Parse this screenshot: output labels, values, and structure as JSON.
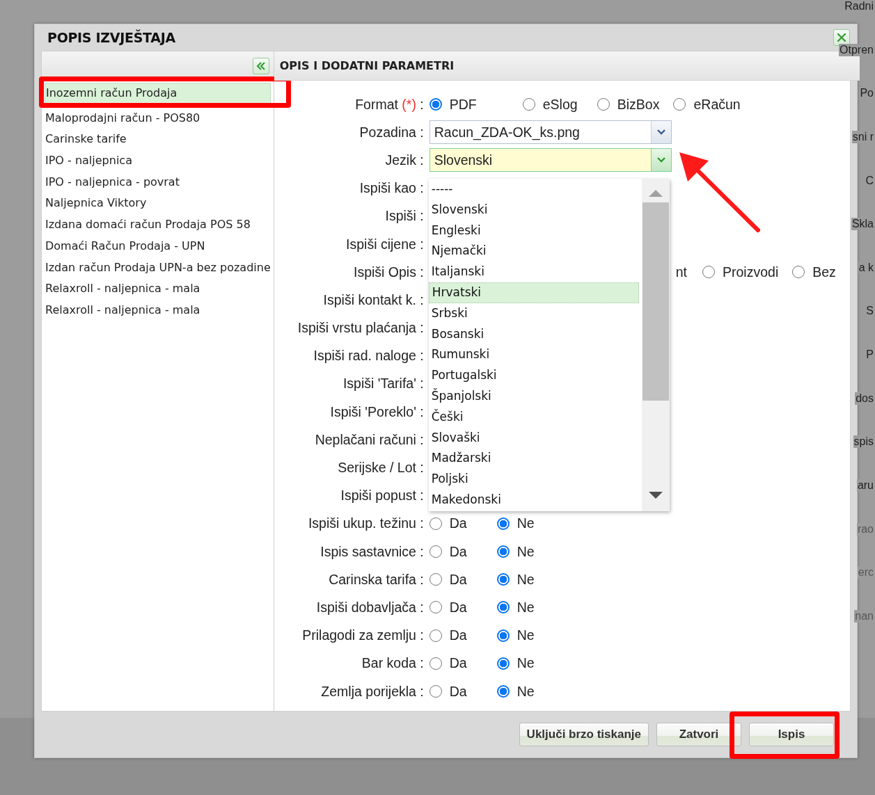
{
  "background_page": {
    "fragments": [
      "Radni",
      "Otpren",
      "Po",
      "sni r",
      "C",
      "Skla",
      "a k",
      "S",
      "P",
      "dos",
      "spis",
      "aru",
      "rao",
      "erc",
      "nan"
    ]
  },
  "dialog": {
    "title": "POPIS IZVJEŠTAJA"
  },
  "report_list": {
    "items": [
      {
        "label": "Inozemni račun Prodaja",
        "selected": true,
        "annotated": true
      },
      {
        "label": "Maloprodajni račun - POS80",
        "selected": false,
        "annotated": false
      },
      {
        "label": "Carinske tarife",
        "selected": false,
        "annotated": false
      },
      {
        "label": "IPO - naljepnica",
        "selected": false,
        "annotated": false
      },
      {
        "label": "IPO - naljepnica - povrat",
        "selected": false,
        "annotated": false
      },
      {
        "label": "Naljepnica Viktory",
        "selected": false,
        "annotated": false
      },
      {
        "label": "Izdana domaći račun Prodaja POS 58",
        "selected": false,
        "annotated": false
      },
      {
        "label": "Domaći Račun Prodaja - UPN",
        "selected": false,
        "annotated": false
      },
      {
        "label": "Izdan račun Prodaja UPN-a bez pozadine",
        "selected": false,
        "annotated": false
      },
      {
        "label": "Relaxroll - naljepnica - mala",
        "selected": false,
        "annotated": false
      },
      {
        "label": "Relaxroll - naljepnica - mala",
        "selected": false,
        "annotated": false
      }
    ]
  },
  "parameters": {
    "title": "OPIS I DODATNI PARAMETRI",
    "rows": [
      {
        "kind": "radio",
        "label": "Format",
        "required_mark": "(*)",
        "label_end": ":",
        "options": [
          {
            "label": "PDF",
            "selected": true
          },
          {
            "label": "eSlog",
            "selected": false
          },
          {
            "label": "BizBox",
            "selected": false
          },
          {
            "label": "eRačun",
            "selected": false
          }
        ]
      },
      {
        "kind": "select",
        "label": "Pozadina :",
        "value": "Racun_ZDA-OK_ks.png",
        "active": false
      },
      {
        "kind": "select",
        "label": "Jezik :",
        "value": "Slovenski",
        "active": true,
        "arrow_annotation": true
      },
      {
        "kind": "covered",
        "label": "Ispiši kao :"
      },
      {
        "kind": "covered",
        "label": "Ispiši :"
      },
      {
        "kind": "covered",
        "label": "Ispiši cijene :"
      },
      {
        "kind": "radio",
        "label": "Ispiši Opis :",
        "fragment": "nt",
        "options": [
          {
            "label": "Proizvodi",
            "selected": false
          },
          {
            "label": "Bez",
            "selected": false
          }
        ]
      },
      {
        "kind": "covered",
        "label": "Ispiši kontakt k. :"
      },
      {
        "kind": "covered",
        "label": "Ispiši vrstu plaćanja :"
      },
      {
        "kind": "covered",
        "label": "Ispiši rad. naloge :"
      },
      {
        "kind": "covered",
        "label": "Ispiši 'Tarifa' :"
      },
      {
        "kind": "covered",
        "label": "Ispiši 'Poreklo' :"
      },
      {
        "kind": "covered",
        "label": "Neplačani računi :"
      },
      {
        "kind": "covered",
        "label": "Serijske / Lot :"
      },
      {
        "kind": "covered",
        "label": "Ispiši popust :"
      },
      {
        "kind": "radio",
        "label": "Ispiši ukup. težinu :",
        "options": [
          {
            "label": "Da",
            "selected": false
          },
          {
            "label": "Ne",
            "selected": true
          }
        ]
      },
      {
        "kind": "radio",
        "label": "Ispis sastavnice :",
        "options": [
          {
            "label": "Da",
            "selected": false
          },
          {
            "label": "Ne",
            "selected": true
          }
        ]
      },
      {
        "kind": "radio",
        "label": "Carinska tarifa :",
        "options": [
          {
            "label": "Da",
            "selected": false
          },
          {
            "label": "Ne",
            "selected": true
          }
        ]
      },
      {
        "kind": "radio",
        "label": "Ispiši dobavljača :",
        "options": [
          {
            "label": "Da",
            "selected": false
          },
          {
            "label": "Ne",
            "selected": true
          }
        ]
      },
      {
        "kind": "radio",
        "label": "Prilagodi za zemlju :",
        "options": [
          {
            "label": "Da",
            "selected": false
          },
          {
            "label": "Ne",
            "selected": true
          }
        ]
      },
      {
        "kind": "radio",
        "label": "Bar koda :",
        "options": [
          {
            "label": "Da",
            "selected": false
          },
          {
            "label": "Ne",
            "selected": true
          }
        ]
      },
      {
        "kind": "radio",
        "label": "Zemlja porijekla :",
        "options": [
          {
            "label": "Da",
            "selected": false
          },
          {
            "label": "Ne",
            "selected": true
          }
        ]
      }
    ]
  },
  "language_dropdown": {
    "options": [
      {
        "label": "-----",
        "hovered": false
      },
      {
        "label": "Slovenski",
        "hovered": false
      },
      {
        "label": "Engleski",
        "hovered": false
      },
      {
        "label": "Njemački",
        "hovered": false
      },
      {
        "label": "Italjanski",
        "hovered": false
      },
      {
        "label": "Hrvatski",
        "hovered": true
      },
      {
        "label": "Srbski",
        "hovered": false
      },
      {
        "label": "Bosanski",
        "hovered": false
      },
      {
        "label": "Rumunski",
        "hovered": false
      },
      {
        "label": "Portugalski",
        "hovered": false
      },
      {
        "label": "Španjolski",
        "hovered": false
      },
      {
        "label": "Češki",
        "hovered": false
      },
      {
        "label": "Slovaški",
        "hovered": false
      },
      {
        "label": "Madžarski",
        "hovered": false
      },
      {
        "label": "Poljski",
        "hovered": false
      },
      {
        "label": "Makedonski",
        "hovered": false
      }
    ]
  },
  "buttons": [
    {
      "label": "Uključi brzo tiskanje",
      "annotated": false
    },
    {
      "label": "Zatvori",
      "annotated": false
    },
    {
      "label": "Ispis",
      "annotated": true
    }
  ]
}
